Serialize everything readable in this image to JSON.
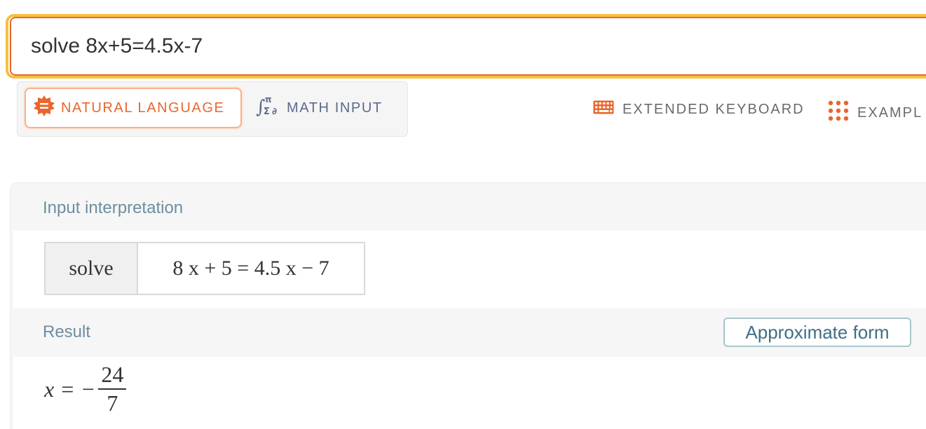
{
  "search": {
    "value": "solve 8x+5=4.5x-7"
  },
  "modes": {
    "natural_language": "NATURAL LANGUAGE",
    "math_input": "MATH INPUT"
  },
  "links": {
    "extended_keyboard": "EXTENDED KEYBOARD",
    "examples": "EXAMPL"
  },
  "pods": {
    "input_interpretation": {
      "title": "Input interpretation",
      "label": "solve",
      "expression": "8 x + 5 = 4.5 x − 7"
    },
    "result": {
      "title": "Result",
      "approx_button": "Approximate form",
      "lhs": "x = −",
      "numerator": "24",
      "denominator": "7"
    }
  },
  "colors": {
    "accent_orange": "#e9662d",
    "focus_yellow": "#f8c13a",
    "pod_title": "#6e8ea0",
    "math_input_blue": "#5b6b8c"
  },
  "icons": {
    "natural_language": "natural-language-badge-icon",
    "math_input": "math-input-icon",
    "keyboard": "keyboard-icon",
    "examples": "dots-grid-icon"
  }
}
